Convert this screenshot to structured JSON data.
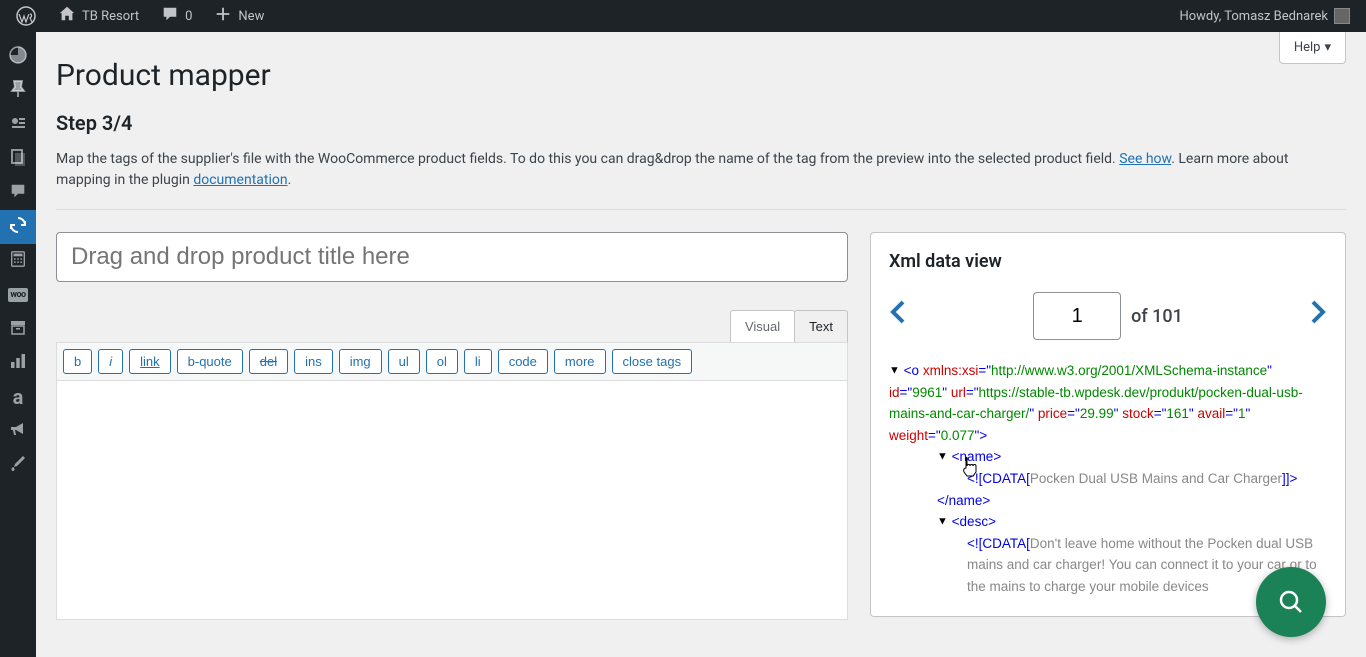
{
  "admin_bar": {
    "site_name": "TB Resort",
    "comments_count": "0",
    "new_label": "New",
    "howdy": "Howdy, Tomasz Bednarek"
  },
  "page": {
    "title": "Product mapper",
    "step": "Step 3/4",
    "intro_text_1": "Map the tags of the supplier's file with the WooCommerce product fields. To do this you can drag&drop the name of the tag from the preview into the selected product field. ",
    "see_how": "See how",
    "intro_text_2": ". Learn more about mapping in the plugin ",
    "documentation": "documentation",
    "intro_text_3": ".",
    "help_label": "Help"
  },
  "mapper": {
    "title_placeholder": "Drag and drop product title here",
    "tabs": {
      "visual": "Visual",
      "text": "Text"
    },
    "toolbar": [
      "b",
      "i",
      "link",
      "b-quote",
      "del",
      "ins",
      "img",
      "ul",
      "ol",
      "li",
      "code",
      "more",
      "close tags"
    ]
  },
  "xml": {
    "panel_title": "Xml data view",
    "page_current": "1",
    "page_total_prefix": "of ",
    "page_total": "101",
    "root": {
      "tag": "o",
      "attrs": [
        {
          "name": "xmlns:xsi",
          "value": "http://www.w3.org/2001/XMLSchema-instance"
        },
        {
          "name": "id",
          "value": "9961"
        },
        {
          "name": "url",
          "value": "https://stable-tb.wpdesk.dev/produkt/pocken-dual-usb-mains-and-car-charger/"
        },
        {
          "name": "price",
          "value": "29.99"
        },
        {
          "name": "stock",
          "value": "161"
        },
        {
          "name": "avail",
          "value": "1"
        },
        {
          "name": "weight",
          "value": "0.077"
        }
      ]
    },
    "children": [
      {
        "tag": "name",
        "cdata": "Pocken Dual USB Mains and Car Charger"
      },
      {
        "tag": "desc",
        "cdata": "Don't leave home without the Pocken dual USB mains and car charger! You can connect it to your car or to the mains to charge your mobile devices"
      }
    ]
  }
}
